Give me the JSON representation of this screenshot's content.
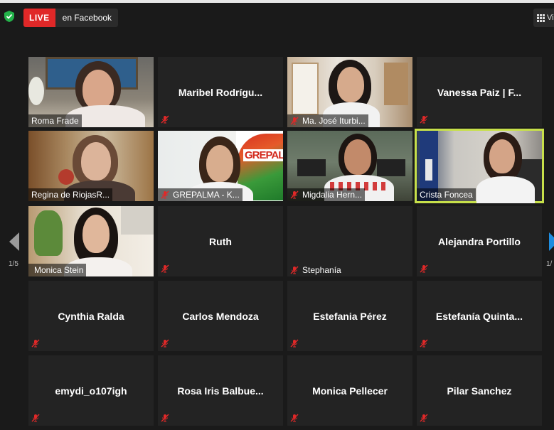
{
  "header": {
    "live_label": "LIVE",
    "stream_target": "en Facebook",
    "view_label": "Vi"
  },
  "pagination": {
    "left": "1/5",
    "right": "1/"
  },
  "colors": {
    "live": "#e02828",
    "active_speaker": "#c7e04a",
    "muted": "#e02828"
  },
  "tiles": [
    {
      "name": "Roma Frade"
    },
    {
      "name": "Maribel  Rodrígu..."
    },
    {
      "name": "Ma. José Iturbi..."
    },
    {
      "name": "Vanessa Paiz | F..."
    },
    {
      "name": "Regina de RiojasR..."
    },
    {
      "name": "GREPALMA - K...",
      "logo": "GREPALMA"
    },
    {
      "name": "Migdalia Hern..."
    },
    {
      "name": "Crista Foncea"
    },
    {
      "name": "Monica Stein"
    },
    {
      "name": "Ruth"
    },
    {
      "name": "Stephanía"
    },
    {
      "name": "Alejandra Portillo"
    },
    {
      "name": "Cynthia Ralda"
    },
    {
      "name": "Carlos Mendoza"
    },
    {
      "name": "Estefania Pérez"
    },
    {
      "name": "Estefanía  Quinta..."
    },
    {
      "name": "emydi_o107igh"
    },
    {
      "name": "Rosa Iris Balbue..."
    },
    {
      "name": "Monica Pellecer"
    },
    {
      "name": "Pilar Sanchez"
    }
  ]
}
